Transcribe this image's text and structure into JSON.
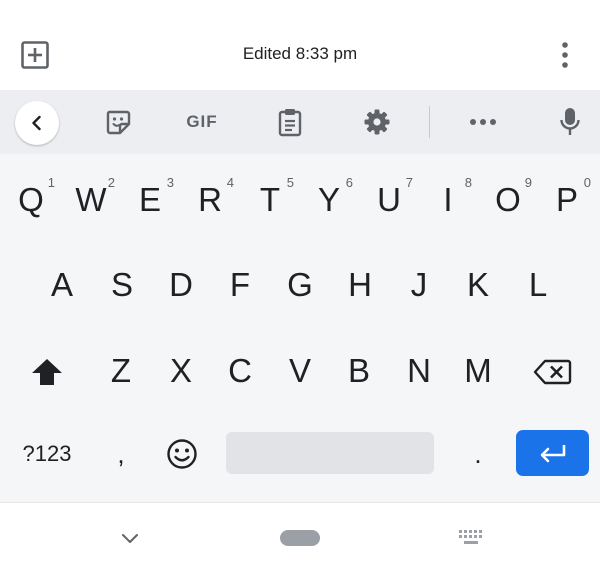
{
  "app_bar": {
    "title": "Edited 8:33 pm",
    "add_icon": "add-box-icon",
    "more_icon": "more-vert-icon"
  },
  "toolbar": {
    "gif_label": "GIF",
    "icons": [
      "back-arrow-icon",
      "sticker-icon",
      "gif-icon",
      "clipboard-icon",
      "settings-gear-icon",
      "more-horiz-icon",
      "microphone-icon"
    ]
  },
  "keyboard": {
    "row1": [
      {
        "label": "Q",
        "hint": "1"
      },
      {
        "label": "W",
        "hint": "2"
      },
      {
        "label": "E",
        "hint": "3"
      },
      {
        "label": "R",
        "hint": "4"
      },
      {
        "label": "T",
        "hint": "5"
      },
      {
        "label": "Y",
        "hint": "6"
      },
      {
        "label": "U",
        "hint": "7"
      },
      {
        "label": "I",
        "hint": "8"
      },
      {
        "label": "O",
        "hint": "9"
      },
      {
        "label": "P",
        "hint": "0"
      }
    ],
    "row2": [
      {
        "label": "A"
      },
      {
        "label": "S"
      },
      {
        "label": "D"
      },
      {
        "label": "F"
      },
      {
        "label": "G"
      },
      {
        "label": "H"
      },
      {
        "label": "J"
      },
      {
        "label": "K"
      },
      {
        "label": "L"
      }
    ],
    "row3": [
      {
        "label": "Z"
      },
      {
        "label": "X"
      },
      {
        "label": "C"
      },
      {
        "label": "V"
      },
      {
        "label": "B"
      },
      {
        "label": "N"
      },
      {
        "label": "M"
      }
    ],
    "bottom": {
      "symbols_label": "?123",
      "comma_label": ",",
      "period_label": "."
    }
  },
  "colors": {
    "accent": "#1a73e8",
    "keyboard_bg": "#f5f6f7",
    "toolbar_bg": "#eceef1",
    "icon": "#5f6368"
  }
}
